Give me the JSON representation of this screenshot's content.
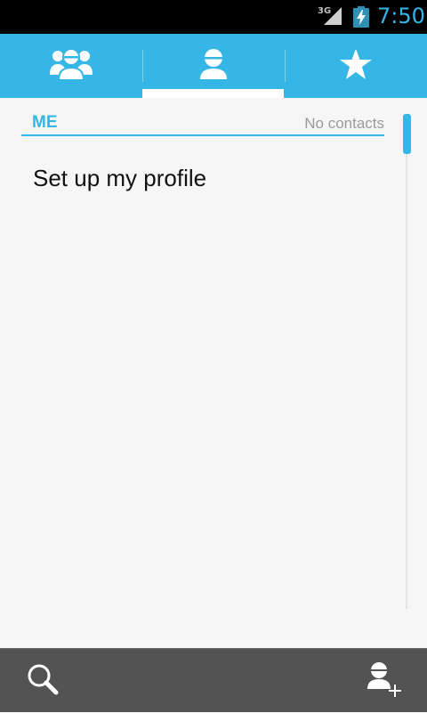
{
  "status_bar": {
    "network": "3G",
    "time": "7:50"
  },
  "tabs": [
    {
      "icon": "groups-icon",
      "selected": false
    },
    {
      "icon": "person-icon",
      "selected": true
    },
    {
      "icon": "star-icon",
      "selected": false
    }
  ],
  "section": {
    "title": "ME",
    "meta": "No contacts"
  },
  "profile": {
    "label": "Set up my profile"
  },
  "bottom_bar": {
    "left_icon": "search-icon",
    "right_icon": "add-contact-icon"
  },
  "colors": {
    "accent": "#36b6e6",
    "status_time": "#33b5e5",
    "bottom_bar": "#535353"
  }
}
